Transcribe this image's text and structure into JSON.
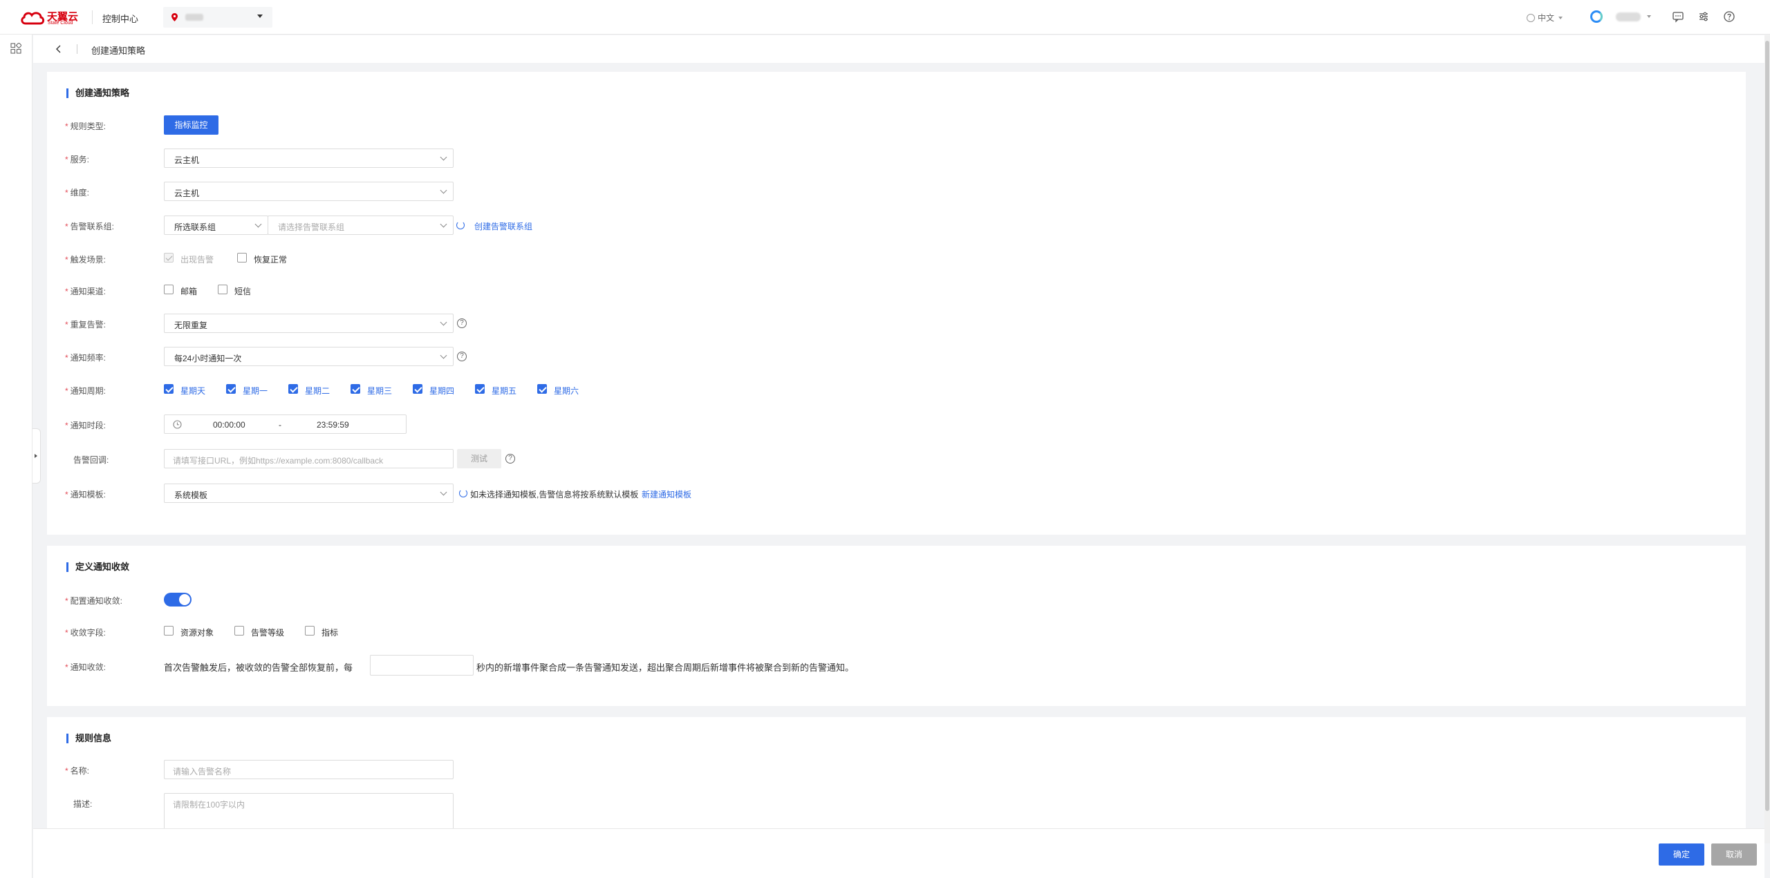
{
  "header": {
    "logo_cn": "天翼云",
    "logo_en": "State Cloud",
    "console_title": "控制中心",
    "language": "中文"
  },
  "page": {
    "title": "创建通知策略"
  },
  "policy": {
    "section_title": "创建通知策略",
    "rule_type": {
      "label": "规则类型:",
      "button": "指标监控"
    },
    "service": {
      "label": "服务:",
      "value": "云主机"
    },
    "dimension": {
      "label": "维度:",
      "value": "云主机"
    },
    "contact_group": {
      "label": "告警联系组:",
      "type_value": "所选联系组",
      "placeholder": "请选择告警联系组",
      "create_link": "创建告警联系组"
    },
    "trigger": {
      "label": "触发场景:",
      "options": [
        {
          "text": "出现告警",
          "checked": true,
          "disabled": true
        },
        {
          "text": "恢复正常",
          "checked": false,
          "disabled": false
        }
      ]
    },
    "channel": {
      "label": "通知渠道:",
      "options": [
        {
          "text": "邮箱",
          "checked": false
        },
        {
          "text": "短信",
          "checked": false
        }
      ]
    },
    "repeat": {
      "label": "重复告警:",
      "value": "无限重复"
    },
    "frequency": {
      "label": "通知频率:",
      "value": "每24小时通知一次"
    },
    "cycle": {
      "label": "通知周期:",
      "days": [
        "星期天",
        "星期一",
        "星期二",
        "星期三",
        "星期四",
        "星期五",
        "星期六"
      ]
    },
    "time_range": {
      "label": "通知时段:",
      "start": "00:00:00",
      "separator": "-",
      "end": "23:59:59"
    },
    "callback": {
      "label": "告警回调:",
      "placeholder": "请填写接口URL，例如https://example.com:8080/callback",
      "test_button": "测试"
    },
    "template": {
      "label": "通知模板:",
      "value": "系统模板",
      "hint": "如未选择通知模板,告警信息将按系统默认模板",
      "new_link": "新建通知模板"
    }
  },
  "convergence": {
    "section_title": "定义通知收敛",
    "config": {
      "label": "配置通知收敛:",
      "enabled": true
    },
    "fields": {
      "label": "收敛字段:",
      "options": [
        "资源对象",
        "告警等级",
        "指标"
      ]
    },
    "notice": {
      "label": "通知收敛:",
      "text_before": "首次告警触发后，被收敛的告警全部恢复前，每",
      "value": "",
      "text_after": "秒内的新增事件聚合成一条告警通知发送，超出聚合周期后新增事件将被聚合到新的告警通知。"
    }
  },
  "rule_info": {
    "section_title": "规则信息",
    "name": {
      "label": "名称:",
      "placeholder": "请输入告警名称"
    },
    "desc": {
      "label": "描述:",
      "placeholder": "请限制在100字以内"
    }
  },
  "footer": {
    "confirm": "确定",
    "cancel": "取消"
  },
  "colors": {
    "primary": "#2e6be6",
    "required": "#e34d59",
    "brand": "#d7000f"
  }
}
